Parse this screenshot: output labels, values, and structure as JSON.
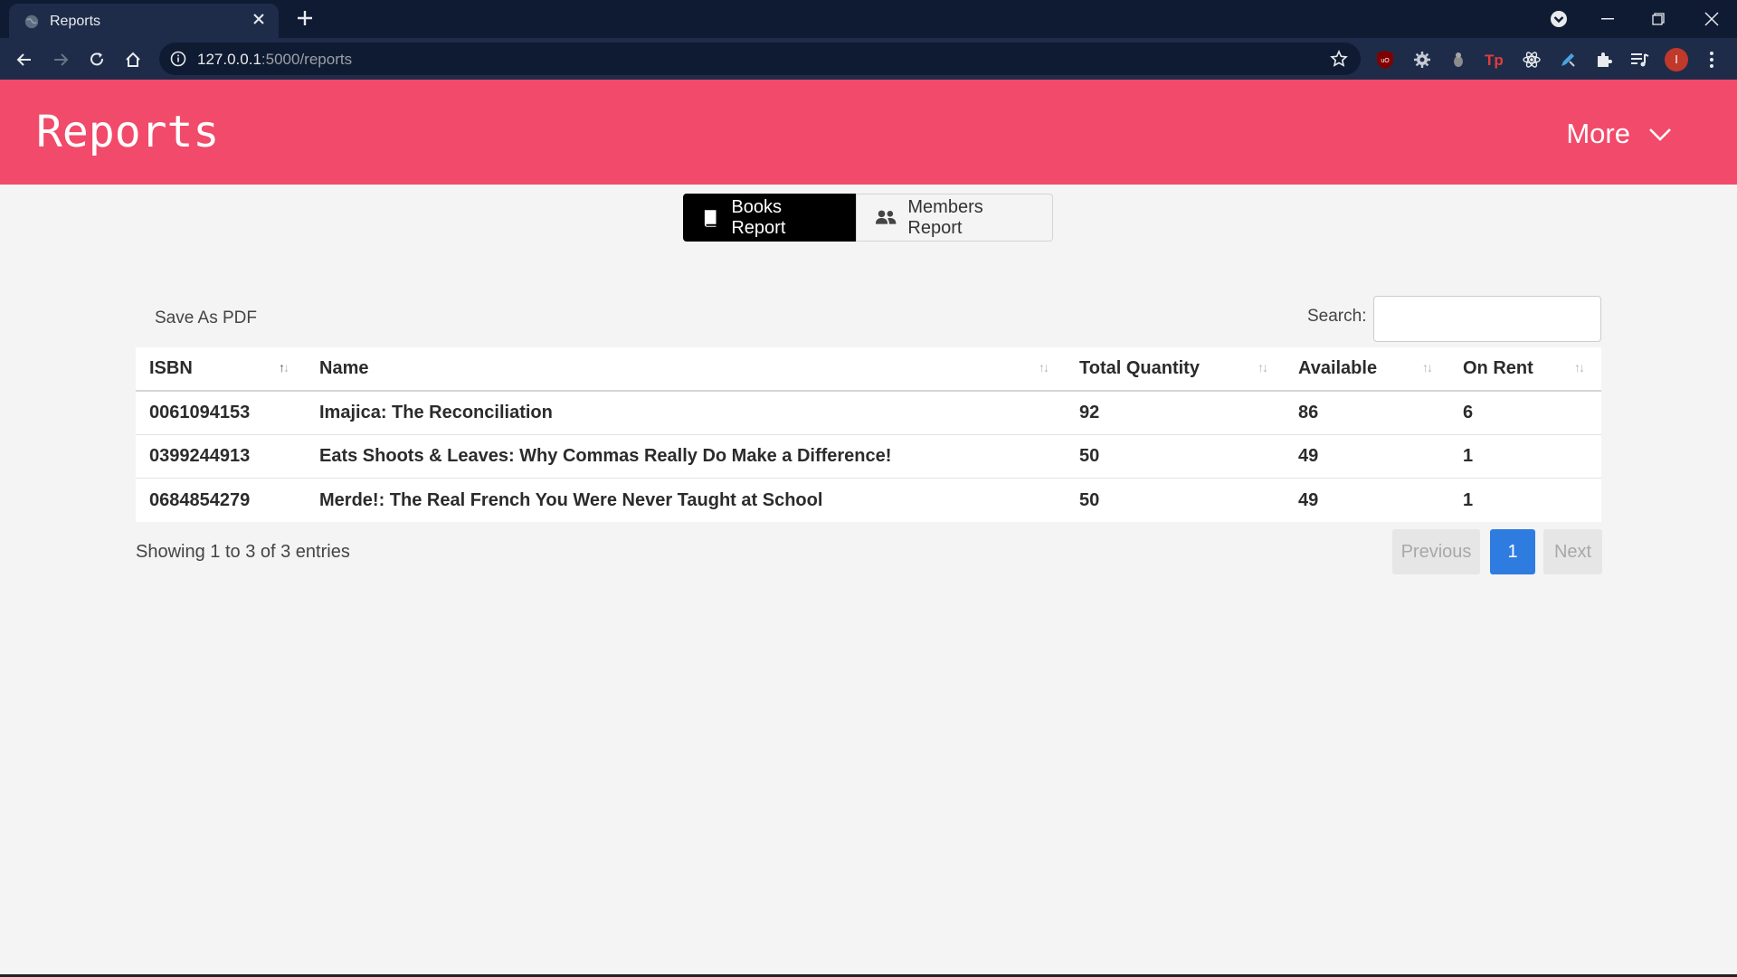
{
  "browser": {
    "tab_title": "Reports",
    "url_host": "127.0.0.1",
    "url_path": ":5000/reports",
    "avatar_initial": "I",
    "icons": [
      "globe-icon",
      "close-icon",
      "plus-icon",
      "back-icon",
      "forward-icon",
      "reload-icon",
      "home-icon",
      "info-icon",
      "star-icon",
      "ublock-icon",
      "gear-icon",
      "extension-icon",
      "tp-icon",
      "react-icon",
      "pen-icon",
      "puzzle-icon",
      "playlist-icon",
      "kebab-icon"
    ]
  },
  "header": {
    "title": "Reports",
    "more_label": "More"
  },
  "toggle": {
    "books_label": "Books Report",
    "members_label": "Members Report",
    "active": "Books Report"
  },
  "controls": {
    "save_pdf_label": "Save As PDF",
    "search_label": "Search:",
    "search_value": ""
  },
  "table": {
    "columns": [
      "ISBN",
      "Name",
      "Total Quantity",
      "Available",
      "On Rent"
    ],
    "rows": [
      [
        "0061094153",
        "Imajica: The Reconciliation",
        "92",
        "86",
        "6"
      ],
      [
        "0399244913",
        "Eats Shoots & Leaves: Why Commas Really Do Make a Difference!",
        "50",
        "49",
        "1"
      ],
      [
        "0684854279",
        "Merde!: The Real French You Were Never Taught at School",
        "50",
        "49",
        "1"
      ]
    ]
  },
  "footer": {
    "info": "Showing 1 to 3 of 3 entries",
    "prev_label": "Previous",
    "page_label": "1",
    "next_label": "Next"
  },
  "colors": {
    "header_bg": "#f24a6a",
    "active_toggle": "#000000",
    "page_active": "#2f7ce1"
  }
}
